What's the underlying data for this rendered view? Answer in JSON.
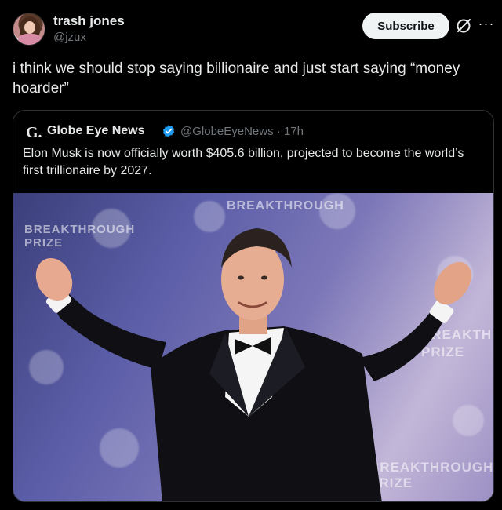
{
  "author": {
    "name": "trash jones",
    "handle": "@jzux"
  },
  "actions": {
    "subscribe_label": "Subscribe",
    "grok_icon": "grok-icon",
    "more_icon": "more-icon"
  },
  "post": {
    "text": "i think we should stop saying billionaire and just start saying “money hoarder”"
  },
  "quote": {
    "logo_letter": "G.",
    "name": "Globe Eye News",
    "handle": "@GlobeEyeNews",
    "separator": "·",
    "time": "17h",
    "meta": "@GlobeEyeNews · 17h",
    "text": "Elon Musk is now officially worth $405.6 billion, projected to become the world’s first trillionaire by 2027.",
    "verified_icon": "verified-badge-icon",
    "verified_color": "#1d9bf0"
  },
  "image": {
    "background_lettering": [
      "BREAKTHROUGH PRIZE",
      "BREAKTHROUGH",
      "BREAKTHRO PRIZE",
      "BREAKTHROUGH PRIZE"
    ]
  },
  "colors": {
    "background": "#000000",
    "text_primary": "#e7e9ea",
    "text_secondary": "#71767b",
    "subscribe_bg": "#eff3f4",
    "border": "#2f3336"
  }
}
